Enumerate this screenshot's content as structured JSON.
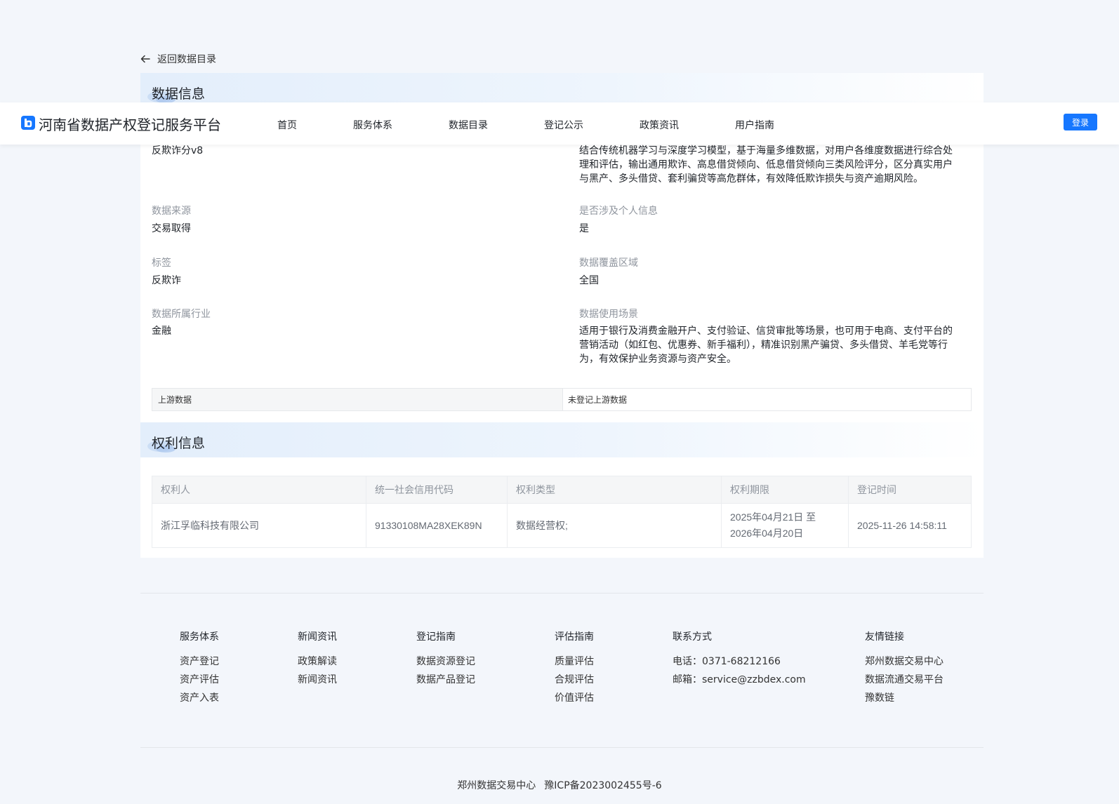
{
  "back_link": "返回数据目录",
  "nav": {
    "brand": "河南省数据产权登记服务平台",
    "menu": [
      "首页",
      "服务体系",
      "数据目录",
      "登记公示",
      "政策资讯",
      "用户指南"
    ],
    "login": "登录"
  },
  "data_info": {
    "title": "数据信息",
    "name_value": "反欺诈分v8",
    "description_value": "结合传统机器学习与深度学习模型，基于海量多维数据，对用户各维度数据进行综合处理和评估，输出通用欺诈、高息借贷倾向、低息借贷倾向三类风险评分，区分真实用户与黑产、多头借贷、套利骗贷等高危群体，有效降低欺诈损失与资产逾期风险。",
    "fields": [
      {
        "label": "数据来源",
        "value": "交易取得"
      },
      {
        "label": "是否涉及个人信息",
        "value": "是"
      },
      {
        "label": "标签",
        "value": "反欺诈"
      },
      {
        "label": "数据覆盖区域",
        "value": "全国"
      },
      {
        "label": "数据所属行业",
        "value": "金融"
      },
      {
        "label": "数据使用场景",
        "value": "适用于银行及消费金融开户、支付验证、信贷审批等场景，也可用于电商、支付平台的营销活动（如红包、优惠券、新手福利），精准识别黑产骗贷、多头借贷、羊毛党等行为，有效保护业务资源与资产安全。"
      }
    ],
    "upstream_label": "上游数据",
    "upstream_value": "未登记上游数据"
  },
  "rights_info": {
    "title": "权利信息",
    "columns": [
      "权利人",
      "统一社会信用代码",
      "权利类型",
      "权利期限",
      "登记时间"
    ],
    "row": {
      "holder": "浙江孚临科技有限公司",
      "credit_code": "91330108MA28XEK89N",
      "right_type": "数据经营权;",
      "period_start": "2025年04月21日 至",
      "period_end": "2026年04月20日",
      "registered_at": "2025-11-26 14:58:11"
    }
  },
  "footer": {
    "columns": [
      {
        "title": "服务体系",
        "items": [
          "资产登记",
          "资产评估",
          "资产入表"
        ]
      },
      {
        "title": "新闻资讯",
        "items": [
          "政策解读",
          "新闻资讯"
        ]
      },
      {
        "title": "登记指南",
        "items": [
          "数据资源登记",
          "数据产品登记"
        ]
      },
      {
        "title": "评估指南",
        "items": [
          "质量评估",
          "合规评估",
          "价值评估"
        ]
      },
      {
        "title": "联系方式",
        "items": [
          "电话：0371-68212166",
          "邮箱：service@zzbdex.com"
        ]
      },
      {
        "title": "友情链接",
        "items": [
          "郑州数据交易中心",
          "数据流通交易平台",
          "豫数链"
        ]
      }
    ],
    "org": "郑州数据交易中心",
    "icp": "豫ICP备2023002455号-6"
  },
  "colors": {
    "accent": "#1677ff",
    "page_bg": "#f3f6fb",
    "label_gray": "#8f959e"
  }
}
